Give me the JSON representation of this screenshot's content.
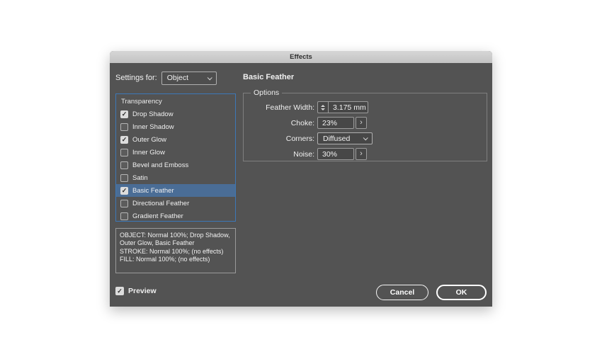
{
  "icons": {
    "checkmark": "✓",
    "popout_chevron": "›"
  },
  "colors": {
    "dialog_bg": "#535353",
    "titlebar_bg": "#cbcbcb",
    "selection_blue": "#4a6d96",
    "list_border_blue": "#3c78b8",
    "text": "#f0f0f0"
  },
  "dialog": {
    "title": "Effects",
    "settings_for_label": "Settings for:",
    "settings_for_value": "Object",
    "panel_title": "Basic Feather",
    "effects_list": {
      "header": "Transparency",
      "items": [
        {
          "label": "Drop Shadow",
          "checked": true,
          "selected": false
        },
        {
          "label": "Inner Shadow",
          "checked": false,
          "selected": false
        },
        {
          "label": "Outer Glow",
          "checked": true,
          "selected": false
        },
        {
          "label": "Inner Glow",
          "checked": false,
          "selected": false
        },
        {
          "label": "Bevel and Emboss",
          "checked": false,
          "selected": false
        },
        {
          "label": "Satin",
          "checked": false,
          "selected": false
        },
        {
          "label": "Basic Feather",
          "checked": true,
          "selected": true
        },
        {
          "label": "Directional Feather",
          "checked": false,
          "selected": false
        },
        {
          "label": "Gradient Feather",
          "checked": false,
          "selected": false
        }
      ]
    },
    "summary": {
      "lines": [
        "OBJECT: Normal 100%; Drop Shadow, Outer Glow, Basic Feather",
        "STROKE: Normal 100%; (no effects)",
        "FILL: Normal 100%; (no effects)"
      ]
    },
    "options": {
      "legend": "Options",
      "fields": [
        {
          "label": "Feather Width:",
          "value": "3.175 mm",
          "control": "stepper"
        },
        {
          "label": "Choke:",
          "value": "23%",
          "control": "popout"
        },
        {
          "label": "Corners:",
          "value": "Diffused",
          "control": "dropdown"
        },
        {
          "label": "Noise:",
          "value": "30%",
          "control": "popout"
        }
      ]
    },
    "preview_label": "Preview",
    "buttons": {
      "cancel": "Cancel",
      "ok": "OK"
    }
  }
}
